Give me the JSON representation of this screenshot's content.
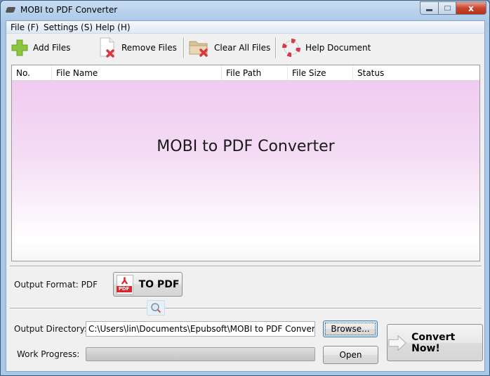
{
  "window": {
    "title": "MOBI to PDF Converter",
    "controls": {
      "minimize": "minimize",
      "maximize": "maximize",
      "close": "x"
    }
  },
  "menu": [
    {
      "label": "File (F)"
    },
    {
      "label": "Settings (S)"
    },
    {
      "label": "Help (H)"
    }
  ],
  "toolbar": {
    "add_files": "Add Files",
    "remove_files": "Remove Files",
    "clear_all_files": "Clear All Files",
    "help_document": "Help Document"
  },
  "file_list": {
    "columns": [
      "No.",
      "File Name",
      "File Path",
      "File Size",
      "Status"
    ],
    "rows": [],
    "watermark": "MOBI to PDF Converter"
  },
  "output_format": {
    "label": "Output Format: PDF",
    "button_label": "TO PDF",
    "pdf_badge": "PDF"
  },
  "output_directory": {
    "label": "Output Directory:",
    "value": "C:\\Users\\lin\\Documents\\Epubsoft\\MOBI to PDF Converter\\Output",
    "browse_label": "Browse..."
  },
  "work_progress": {
    "label": "Work Progress:",
    "percent": 0,
    "open_label": "Open"
  },
  "convert": {
    "label": "Convert Now!"
  },
  "colors": {
    "accent_blue": "#3c7fb1",
    "list_gradient_top": "#f0c8f0",
    "close_red": "#c7452f",
    "pdf_red": "#d9262b",
    "add_green": "#7dc242"
  }
}
